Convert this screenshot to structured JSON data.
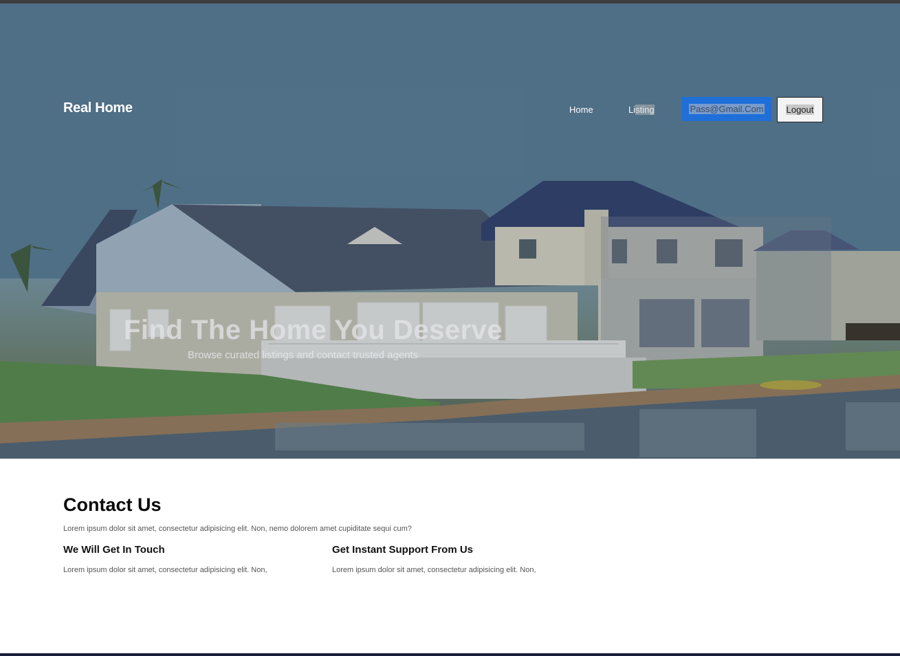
{
  "brand": "Real Home",
  "nav": {
    "home": "Home",
    "listing_part1": "Li",
    "listing_part2": "sting",
    "email": "Pass@Gmail.Com",
    "logout": "Logout"
  },
  "hero": {
    "title": "Find The Home You Deserve",
    "subtitle": "Browse curated listings and contact trusted agents"
  },
  "contact": {
    "title": "Contact Us",
    "description": "Lorem ipsum dolor sit amet, consectetur adipisicing elit. Non, nemo dolorem amet cupiditate sequi cum?",
    "columns": [
      {
        "heading": "We Will Get In Touch",
        "text": "Lorem ipsum dolor sit amet, consectetur adipisicing elit. Non,"
      },
      {
        "heading": "Get Instant Support From Us",
        "text": "Lorem ipsum dolor sit amet, consectetur adipisicing elit. Non,"
      }
    ]
  },
  "colors": {
    "primary_button": "#1f6fd9",
    "footer": "#1a1f3a"
  }
}
